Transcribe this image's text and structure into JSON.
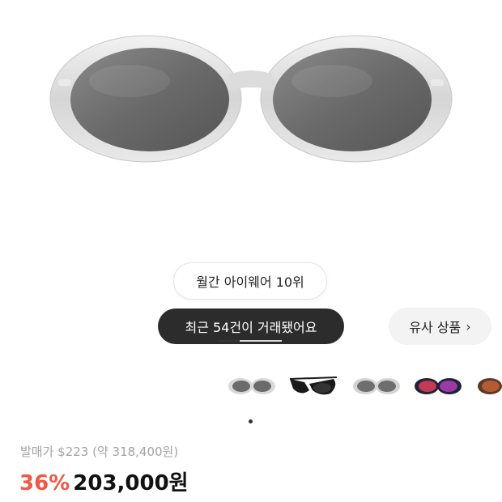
{
  "product": {
    "image_alt": "silver oval sunglasses with dark grey lenses",
    "badges": {
      "rank": "월간 아이웨어 10위",
      "recent_trades": "최근 54건이 거래됐어요"
    },
    "similar_button_label": "유사 상품"
  },
  "gallery": {
    "thumbnails": [
      {
        "name": "silver-grey",
        "frame": "#d9d9d9",
        "lens": "#6b6b6b"
      },
      {
        "name": "black-grey",
        "frame": "#1a1a1a",
        "lens": "#333333"
      },
      {
        "name": "silver-grey-2",
        "frame": "#d4d4d4",
        "lens": "#6e6e6e"
      },
      {
        "name": "navy-ruby",
        "frame": "#20223a",
        "lens": "#c23a55"
      },
      {
        "name": "brown-bronze",
        "frame": "#5a3b2a",
        "lens": "#b55a32"
      }
    ]
  },
  "pricing": {
    "retail_text": "발매가 $223 (약 318,400원)",
    "discount": "36%",
    "price": "203,000원"
  },
  "colors": {
    "discount": "#f15746",
    "dark_chip": "#2c2c2c"
  }
}
